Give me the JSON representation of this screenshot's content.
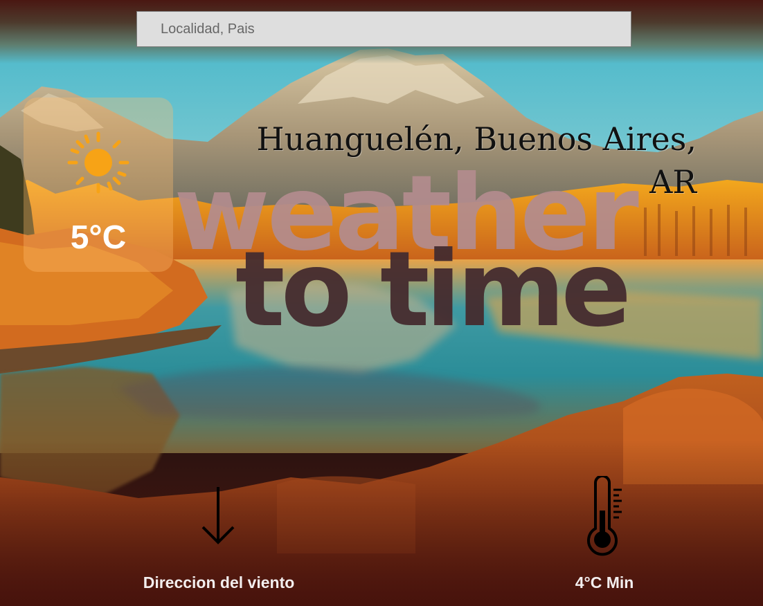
{
  "search": {
    "placeholder": "Localidad, Pais",
    "value": ""
  },
  "current": {
    "temperature": "5°C",
    "condition_icon": "sun-icon"
  },
  "location": {
    "line1": "Huanguelén, Buenos Aires,",
    "line2": "AR"
  },
  "logo": {
    "word1": "weather",
    "word2": "to time"
  },
  "details": {
    "wind_label": "Direccion del viento",
    "wind_icon": "arrow-down-icon",
    "min_label": "4°C Min",
    "min_icon": "thermometer-icon"
  },
  "colors": {
    "sun": "#f7a316",
    "logo_top": "#b38c8e",
    "logo_bottom": "#452c2f",
    "card": "#ffbe6e"
  }
}
